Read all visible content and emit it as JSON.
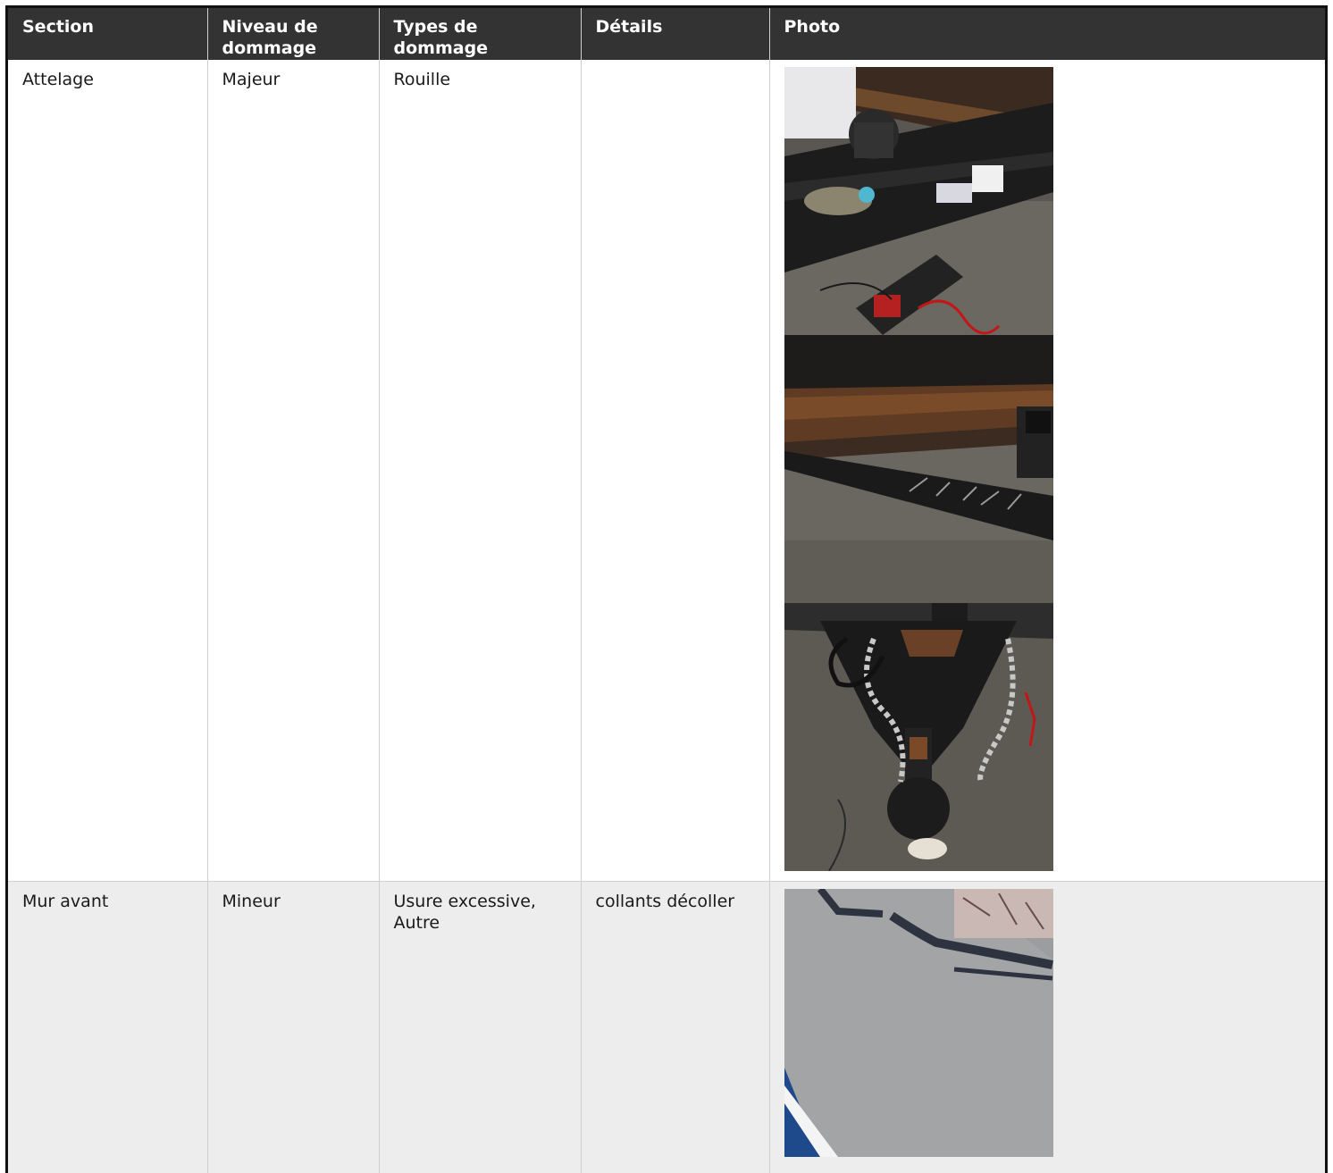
{
  "table": {
    "headers": {
      "section": "Section",
      "niveau_line1": "Niveau de",
      "niveau_line2": "dommage",
      "types_line1": "Types de",
      "types_line2": "dommage",
      "details": "Détails",
      "photo": "Photo"
    },
    "rows": [
      {
        "section": "Attelage",
        "niveau": "Majeur",
        "types_line1": "Rouille",
        "types_line2": "",
        "details": "",
        "photos": [
          "trailer-frame-battery-photo",
          "trailer-frame-rust-photo",
          "hitch-coupler-chains-photo"
        ]
      },
      {
        "section": "Mur avant",
        "niveau": "Mineur",
        "types_line1": "Usure excessive,",
        "types_line2": "Autre",
        "details": "collants décoller",
        "photos": [
          "front-wall-decal-photo"
        ]
      }
    ]
  },
  "colors": {
    "header_bg": "#333333",
    "header_text": "#ffffff",
    "row_alt_bg": "#ededed",
    "border": "#cfcfcf"
  }
}
